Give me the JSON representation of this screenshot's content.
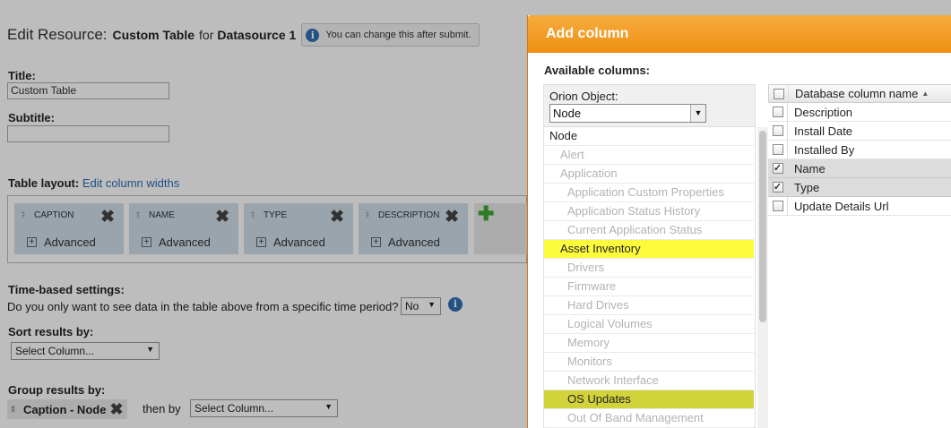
{
  "page": {
    "header_main": "Edit Resource:",
    "header_resource": "Custom Table",
    "header_for": "for",
    "header_datasource": "Datasource 1",
    "header_info": "You can change this after submit.",
    "title_label": "Title:",
    "title_value": "Custom Table",
    "subtitle_label": "Subtitle:",
    "subtitle_value": "",
    "table_layout_label": "Table layout:",
    "edit_widths_link": "Edit column widths",
    "columns": [
      {
        "caption": "CAPTION",
        "advanced": "Advanced"
      },
      {
        "caption": "NAME",
        "advanced": "Advanced"
      },
      {
        "caption": "TYPE",
        "advanced": "Advanced"
      },
      {
        "caption": "DESCRIPTION",
        "advanced": "Advanced"
      }
    ],
    "time_label": "Time-based settings:",
    "time_question": "Do you only want to see data in the table above from a specific time period?",
    "time_value": "No",
    "sort_label": "Sort results by:",
    "sort_value": "Select Column...",
    "group_label": "Group results by:",
    "group_chip": "Caption - Node",
    "then_by": "then by",
    "then_by_value": "Select Column..."
  },
  "dialog": {
    "title": "Add column",
    "available_label": "Available columns:",
    "orion_label": "Orion Object:",
    "orion_value": "Node",
    "tree": [
      {
        "label": "Node",
        "level": 0,
        "highlight": "",
        "dark": true
      },
      {
        "label": "Alert",
        "level": 1,
        "highlight": "",
        "dark": false
      },
      {
        "label": "Application",
        "level": 1,
        "highlight": "",
        "dark": false
      },
      {
        "label": "Application Custom Properties",
        "level": 2,
        "highlight": "",
        "dark": false
      },
      {
        "label": "Application Status History",
        "level": 2,
        "highlight": "",
        "dark": false
      },
      {
        "label": "Current Application Status",
        "level": 2,
        "highlight": "",
        "dark": false
      },
      {
        "label": "Asset Inventory",
        "level": 1,
        "highlight": "#fbfb3c",
        "dark": true
      },
      {
        "label": "Drivers",
        "level": 2,
        "highlight": "",
        "dark": false
      },
      {
        "label": "Firmware",
        "level": 2,
        "highlight": "",
        "dark": false
      },
      {
        "label": "Hard Drives",
        "level": 2,
        "highlight": "",
        "dark": false
      },
      {
        "label": "Logical Volumes",
        "level": 2,
        "highlight": "",
        "dark": false
      },
      {
        "label": "Memory",
        "level": 2,
        "highlight": "",
        "dark": false
      },
      {
        "label": "Monitors",
        "level": 2,
        "highlight": "",
        "dark": false
      },
      {
        "label": "Network Interface",
        "level": 2,
        "highlight": "",
        "dark": false
      },
      {
        "label": "OS Updates",
        "level": 2,
        "highlight": "#d2d23a",
        "dark": true
      },
      {
        "label": "Out Of Band Management",
        "level": 2,
        "highlight": "",
        "dark": false
      }
    ],
    "db_header": "Database column name",
    "db_rows": [
      {
        "label": "Description",
        "checked": false
      },
      {
        "label": "Install Date",
        "checked": false
      },
      {
        "label": "Installed By",
        "checked": false
      },
      {
        "label": "Name",
        "checked": true
      },
      {
        "label": "Type",
        "checked": true
      },
      {
        "label": "Update Details Url",
        "checked": false
      }
    ]
  },
  "colors": {
    "accent_orange": "#ef8f12",
    "link_blue": "#2b6db3",
    "highlight_yellow": "#fbfb3c",
    "highlight_olive": "#d2d23a",
    "add_green": "#3ea832"
  }
}
